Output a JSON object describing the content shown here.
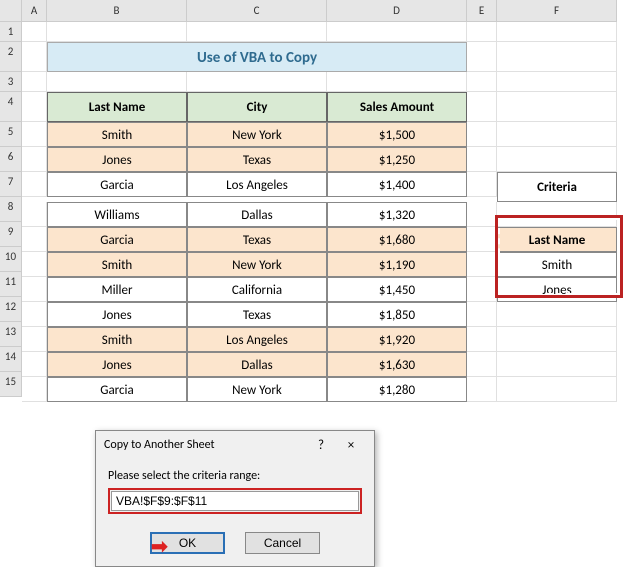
{
  "columns": [
    "A",
    "B",
    "C",
    "D",
    "E",
    "F"
  ],
  "rows": [
    "1",
    "2",
    "3",
    "4",
    "5",
    "6",
    "7",
    "8",
    "9",
    "10",
    "11",
    "12",
    "13",
    "14",
    "15"
  ],
  "title": "Use of VBA to Copy",
  "headers": {
    "lastname": "Last Name",
    "city": "City",
    "sales": "Sales Amount"
  },
  "data": [
    {
      "ln": "Smith",
      "city": "New York",
      "amt": "$1,500"
    },
    {
      "ln": "Jones",
      "city": "Texas",
      "amt": "$1,250"
    },
    {
      "ln": "Garcia",
      "city": "Los Angeles",
      "amt": "$1,400"
    },
    {
      "ln": "Williams",
      "city": "Dallas",
      "amt": "$1,320"
    },
    {
      "ln": "Garcia",
      "city": "Texas",
      "amt": "$1,680"
    },
    {
      "ln": "Smith",
      "city": "New York",
      "amt": "$1,190"
    },
    {
      "ln": "Miller",
      "city": "California",
      "amt": "$1,450"
    },
    {
      "ln": "Jones",
      "city": "Texas",
      "amt": "$1,850"
    },
    {
      "ln": "Smith",
      "city": "Los Angeles",
      "amt": "$1,920"
    },
    {
      "ln": "Jones",
      "city": "Dallas",
      "amt": "$1,630"
    },
    {
      "ln": "Garcia",
      "city": "New York",
      "amt": "$1,280"
    }
  ],
  "criteria": {
    "label": "Criteria",
    "header": "Last Name",
    "values": [
      "Smith",
      "Jones"
    ]
  },
  "dialog": {
    "title": "Copy to Another Sheet",
    "help": "?",
    "close": "×",
    "prompt": "Please select the criteria range:",
    "input": "VBA!$F$9:$F$11",
    "ok": "OK",
    "cancel": "Cancel"
  },
  "chart_data": {
    "type": "table",
    "title": "Use of VBA to Copy",
    "columns": [
      "Last Name",
      "City",
      "Sales Amount"
    ],
    "rows": [
      [
        "Smith",
        "New York",
        1500
      ],
      [
        "Jones",
        "Texas",
        1250
      ],
      [
        "Garcia",
        "Los Angeles",
        1400
      ],
      [
        "Williams",
        "Dallas",
        1320
      ],
      [
        "Garcia",
        "Texas",
        1680
      ],
      [
        "Smith",
        "New York",
        1190
      ],
      [
        "Miller",
        "California",
        1450
      ],
      [
        "Jones",
        "Texas",
        1850
      ],
      [
        "Smith",
        "Los Angeles",
        1920
      ],
      [
        "Jones",
        "Dallas",
        1630
      ],
      [
        "Garcia",
        "New York",
        1280
      ]
    ]
  }
}
